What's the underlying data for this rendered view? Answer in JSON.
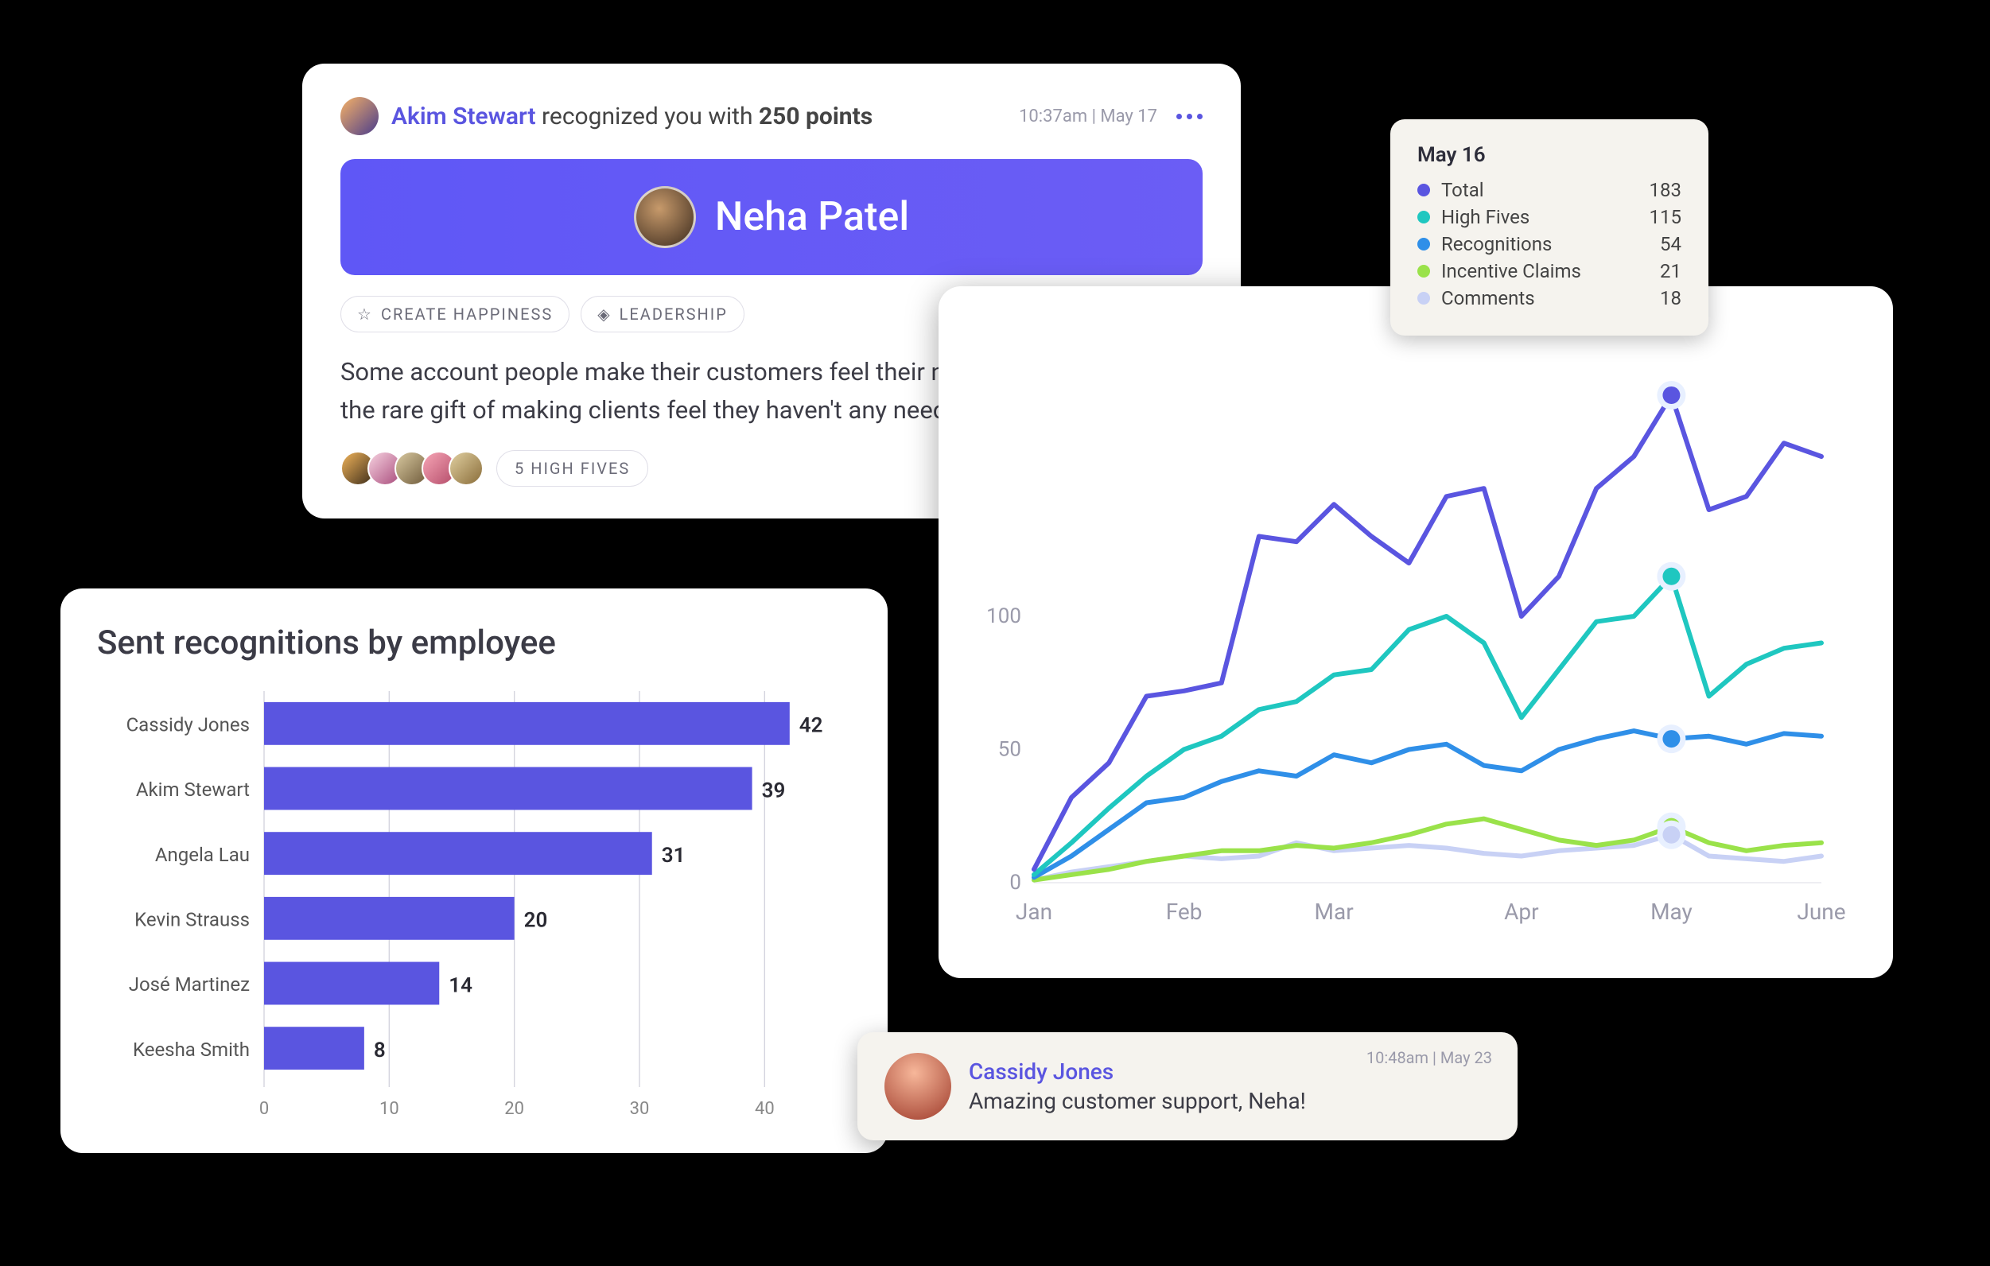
{
  "recognition": {
    "author": "Akim Stewart",
    "verb_pre": " recognized you with ",
    "points": "250 points",
    "timestamp": "10:37am | May 17",
    "recipient": "Neha Patel",
    "tags": [
      {
        "icon": "star-icon",
        "glyph": "☆",
        "label": "CREATE HAPPINESS"
      },
      {
        "icon": "diamond-icon",
        "glyph": "◈",
        "label": "LEADERSHIP"
      }
    ],
    "body": "Some account people make their customers feel their needs are met; you have the rare gift of making clients feel they haven't any needs.",
    "high_five_count_label": "5 HIGH FIVES"
  },
  "tooltip": {
    "title": "May 16",
    "rows": [
      {
        "label": "Total",
        "value": 183,
        "color": "#5a55e0"
      },
      {
        "label": "High Fives",
        "value": 115,
        "color": "#1fc7c0"
      },
      {
        "label": "Recognitions",
        "value": 54,
        "color": "#2f8fe8"
      },
      {
        "label": "Incentive Claims",
        "value": 21,
        "color": "#9ae24a"
      },
      {
        "label": "Comments",
        "value": 18,
        "color": "#c8d1f5"
      }
    ]
  },
  "comment": {
    "author": "Cassidy Jones",
    "text": "Amazing customer support, Neha!",
    "timestamp": "10:48am | May 23"
  },
  "chart_data": [
    {
      "id": "line-chart",
      "type": "line",
      "xlabel": "",
      "ylabel": "",
      "ylim": [
        0,
        200
      ],
      "yticks": [
        0,
        50,
        100
      ],
      "x": [
        "Jan",
        "",
        "",
        "",
        "Feb",
        "",
        "",
        "",
        "Mar",
        "",
        "",
        "",
        "Apr",
        "",
        "",
        "",
        "May",
        "",
        "",
        "",
        "June",
        ""
      ],
      "x_tick_labels": [
        "Jan",
        "Feb",
        "Mar",
        "Apr",
        "May",
        "June"
      ],
      "series": [
        {
          "name": "Total",
          "color": "#5a55e0",
          "values": [
            5,
            32,
            45,
            70,
            72,
            75,
            130,
            128,
            142,
            130,
            120,
            145,
            148,
            100,
            115,
            148,
            160,
            183,
            140,
            145,
            165,
            160
          ]
        },
        {
          "name": "High Fives",
          "color": "#1fc7c0",
          "values": [
            3,
            15,
            28,
            40,
            50,
            55,
            65,
            68,
            78,
            80,
            95,
            100,
            90,
            62,
            80,
            98,
            100,
            115,
            70,
            82,
            88,
            90
          ]
        },
        {
          "name": "Recognitions",
          "color": "#2f8fe8",
          "values": [
            2,
            10,
            20,
            30,
            32,
            38,
            42,
            40,
            48,
            45,
            50,
            52,
            44,
            42,
            50,
            54,
            57,
            54,
            55,
            52,
            56,
            55
          ]
        },
        {
          "name": "Incentive Claims",
          "color": "#9ae24a",
          "values": [
            1,
            3,
            5,
            8,
            10,
            12,
            12,
            14,
            13,
            15,
            18,
            22,
            24,
            20,
            16,
            14,
            16,
            21,
            15,
            12,
            14,
            15
          ]
        },
        {
          "name": "Comments",
          "color": "#c8d1f5",
          "values": [
            1,
            4,
            6,
            8,
            10,
            9,
            10,
            15,
            12,
            13,
            14,
            13,
            11,
            10,
            12,
            13,
            14,
            18,
            10,
            9,
            8,
            10
          ]
        }
      ],
      "highlight_index": 17
    },
    {
      "id": "bar-chart",
      "type": "bar",
      "title": "Sent recognitions by employee",
      "xlabel": "",
      "ylabel": "",
      "xlim": [
        0,
        45
      ],
      "xticks": [
        0,
        10,
        20,
        30,
        40
      ],
      "categories": [
        "Cassidy Jones",
        "Akim Stewart",
        "Angela Lau",
        "Kevin Strauss",
        "José Martinez",
        "Keesha Smith"
      ],
      "values": [
        42,
        39,
        31,
        20,
        14,
        8
      ]
    }
  ]
}
